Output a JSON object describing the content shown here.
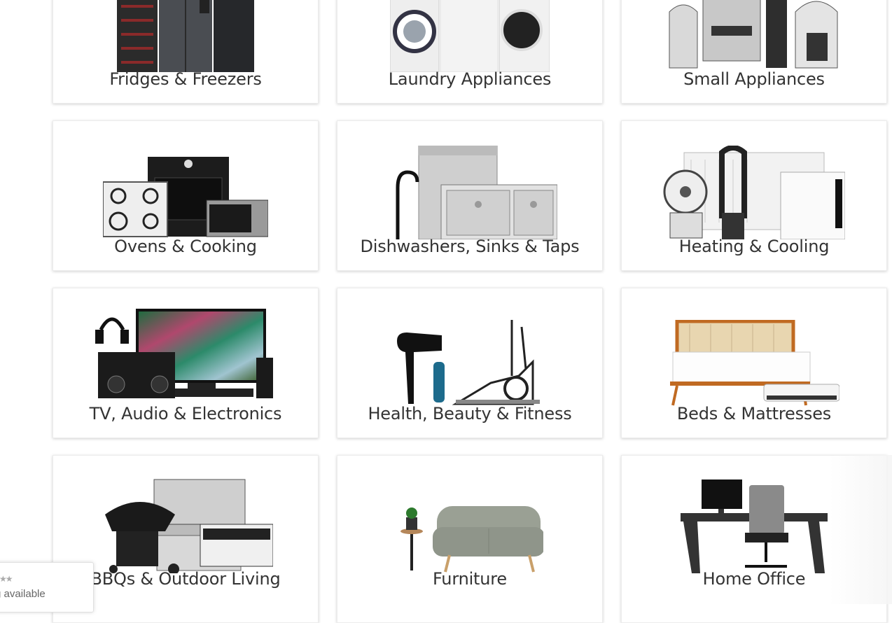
{
  "categories": [
    {
      "label": "Fridges & Freezers",
      "icon": "fridge-freezer-image"
    },
    {
      "label": "Laundry Appliances",
      "icon": "washer-dryer-image"
    },
    {
      "label": "Small Appliances",
      "icon": "small-appliances-image"
    },
    {
      "label": "Ovens & Cooking",
      "icon": "oven-cooktop-image"
    },
    {
      "label": "Dishwashers, Sinks & Taps",
      "icon": "dishwasher-sink-image"
    },
    {
      "label": "Heating & Cooling",
      "icon": "heater-fan-image"
    },
    {
      "label": "TV, Audio & Electronics",
      "icon": "tv-audio-image"
    },
    {
      "label": "Health, Beauty & Fitness",
      "icon": "hairdryer-treadmill-image"
    },
    {
      "label": "Beds & Mattresses",
      "icon": "bed-mattress-image"
    },
    {
      "label": "BBQs & Outdoor Living",
      "icon": "bbq-grill-image"
    },
    {
      "label": "Furniture",
      "icon": "sofa-image"
    },
    {
      "label": "Home Office",
      "icon": "desk-chair-image"
    }
  ],
  "review_badge": {
    "stars": "★★",
    "text": "g available"
  }
}
